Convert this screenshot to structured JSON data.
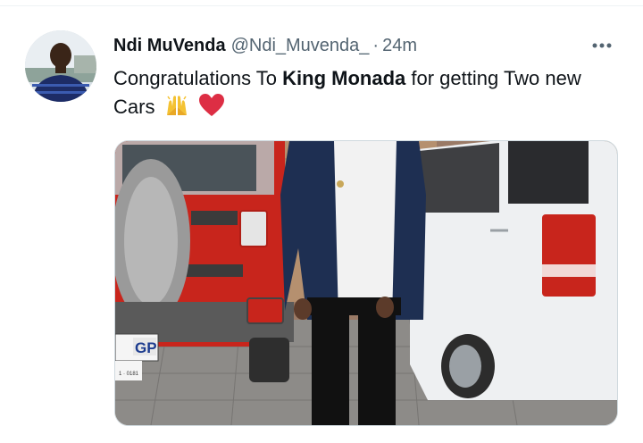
{
  "tweet": {
    "author_name": "Ndi MuVenda",
    "handle": "@Ndi_Muvenda_",
    "separator": "·",
    "time": "24m",
    "text_part1": "Congratulations To ",
    "text_bold": "King Monada",
    "text_part2": " for getting Two new Cars",
    "emojis": [
      "raising-hands-icon",
      "red-heart-icon"
    ]
  },
  "media": {
    "plate_text": "GP",
    "plate_number": "1 · 0181"
  },
  "colors": {
    "text": "#0f1419",
    "muted": "#536471",
    "jeep_red": "#c8251c",
    "van_white": "#eef0f2"
  }
}
